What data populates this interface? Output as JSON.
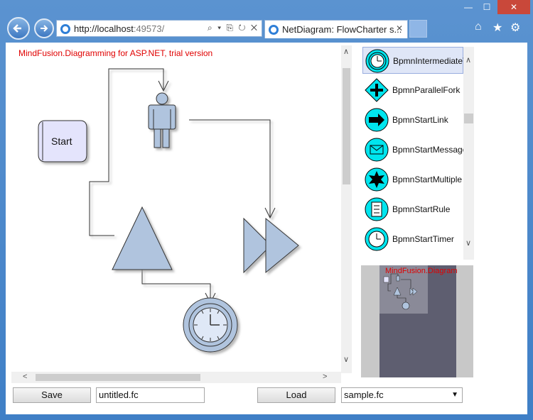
{
  "browser": {
    "address": {
      "host": "http://localhost",
      "port": ":49573/"
    },
    "address_tools": "⌕ ▾ ⎘ ↻ ✕",
    "tab_title": "NetDiagram: FlowCharter s...",
    "tab_close": "✕",
    "window_controls": {
      "minimize": "—",
      "maximize": "☐",
      "close": "✕"
    },
    "toolbar": {
      "home": "⌂",
      "favorites": "★",
      "settings": "⚙"
    }
  },
  "diagram": {
    "trial_text": "MindFusion.Diagramming for ASP.NET, trial version",
    "start_label": "Start"
  },
  "palette": {
    "items": [
      {
        "label": "BpmnIntermediateT",
        "icon": "clock-icon"
      },
      {
        "label": "BpmnParallelFork",
        "icon": "plus-icon"
      },
      {
        "label": "BpmnStartLink",
        "icon": "arrow-icon"
      },
      {
        "label": "BpmnStartMessage",
        "icon": "envelope-icon"
      },
      {
        "label": "BpmnStartMultiple",
        "icon": "star-icon"
      },
      {
        "label": "BpmnStartRule",
        "icon": "document-icon"
      },
      {
        "label": "BpmnStartTimer",
        "icon": "clock-icon"
      }
    ]
  },
  "overview": {
    "label": "MindFusion.Diagram"
  },
  "footer": {
    "save_label": "Save",
    "filename_value": "untitled.fc",
    "load_label": "Load",
    "file_select_value": "sample.fc"
  },
  "colors": {
    "shape_fill": "#b0c4de",
    "accent_red": "#e00000",
    "palette_icon": "#00e5ee"
  }
}
